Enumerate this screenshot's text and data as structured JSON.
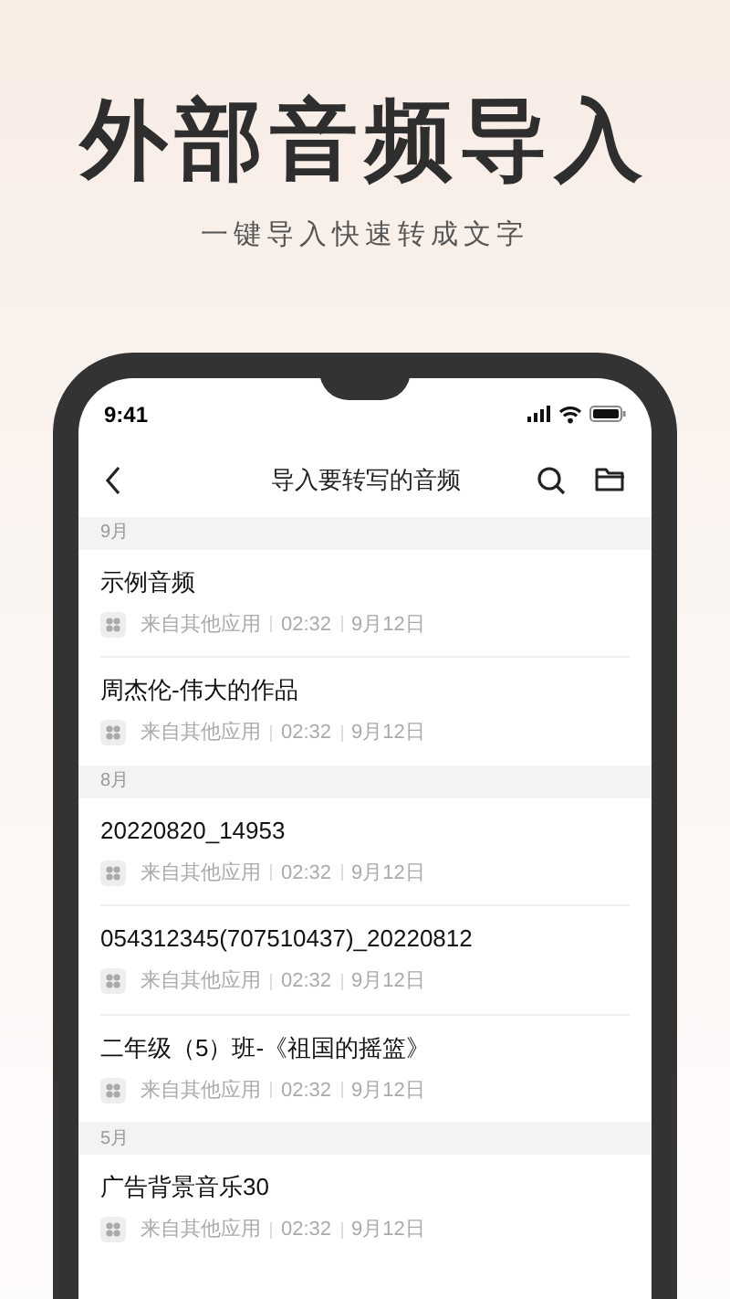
{
  "headline": "外部音频导入",
  "subheadline": "一键导入快速转成文字",
  "status_bar": {
    "time": "9:41"
  },
  "nav": {
    "title": "导入要转写的音频"
  },
  "sections": [
    {
      "label": "9月",
      "items": [
        {
          "title": "示例音频",
          "source": "来自其他应用",
          "duration": "02:32",
          "date": "9月12日"
        },
        {
          "title": "周杰伦-伟大的作品",
          "source": "来自其他应用",
          "duration": "02:32",
          "date": "9月12日"
        }
      ]
    },
    {
      "label": "8月",
      "items": [
        {
          "title": "20220820_14953",
          "source": "来自其他应用",
          "duration": "02:32",
          "date": "9月12日"
        },
        {
          "title": "054312345(707510437)_20220812",
          "source": "来自其他应用",
          "duration": "02:32",
          "date": "9月12日"
        },
        {
          "title": "二年级（5）班-《祖国的摇篮》",
          "source": "来自其他应用",
          "duration": "02:32",
          "date": "9月12日"
        }
      ]
    },
    {
      "label": "5月",
      "items": [
        {
          "title": "广告背景音乐30",
          "source": "来自其他应用",
          "duration": "02:32",
          "date": "9月12日"
        }
      ]
    }
  ]
}
